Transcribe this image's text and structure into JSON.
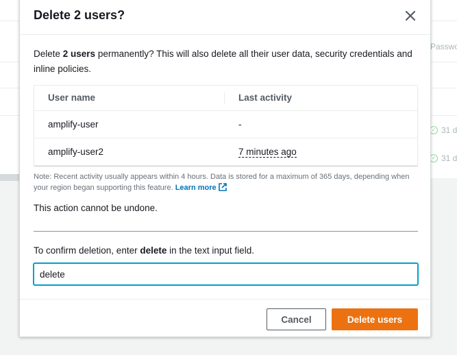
{
  "background": {
    "column_header_fragment": "Passwo",
    "activity_fragment_1": "31 d",
    "activity_fragment_2": "31 d"
  },
  "modal": {
    "title": "Delete 2 users?",
    "close_icon": "close-icon",
    "intro_prefix": "Delete ",
    "intro_count": "2 users",
    "intro_suffix": " permanently? This will also delete all their user data, security credentials and inline policies.",
    "table": {
      "columns": [
        "User name",
        "Last activity"
      ],
      "rows": [
        {
          "user_name": "amplify-user",
          "last_activity": "-"
        },
        {
          "user_name": "amplify-user2",
          "last_activity": "7 minutes ago"
        }
      ]
    },
    "note": "Note: Recent activity usually appears within 4 hours. Data is stored for a maximum of 365 days, depending when your region began supporting this feature. ",
    "learn_more": "Learn more",
    "undone_text": "This action cannot be undone.",
    "confirm_prefix": "To confirm deletion, enter ",
    "confirm_keyword": "delete",
    "confirm_suffix": " in the text input field.",
    "confirm_value": "delete",
    "cancel_label": "Cancel",
    "delete_label": "Delete users"
  },
  "colors": {
    "primary_button": "#ec7211",
    "link": "#0073bb",
    "input_focus": "#00a1c9"
  }
}
